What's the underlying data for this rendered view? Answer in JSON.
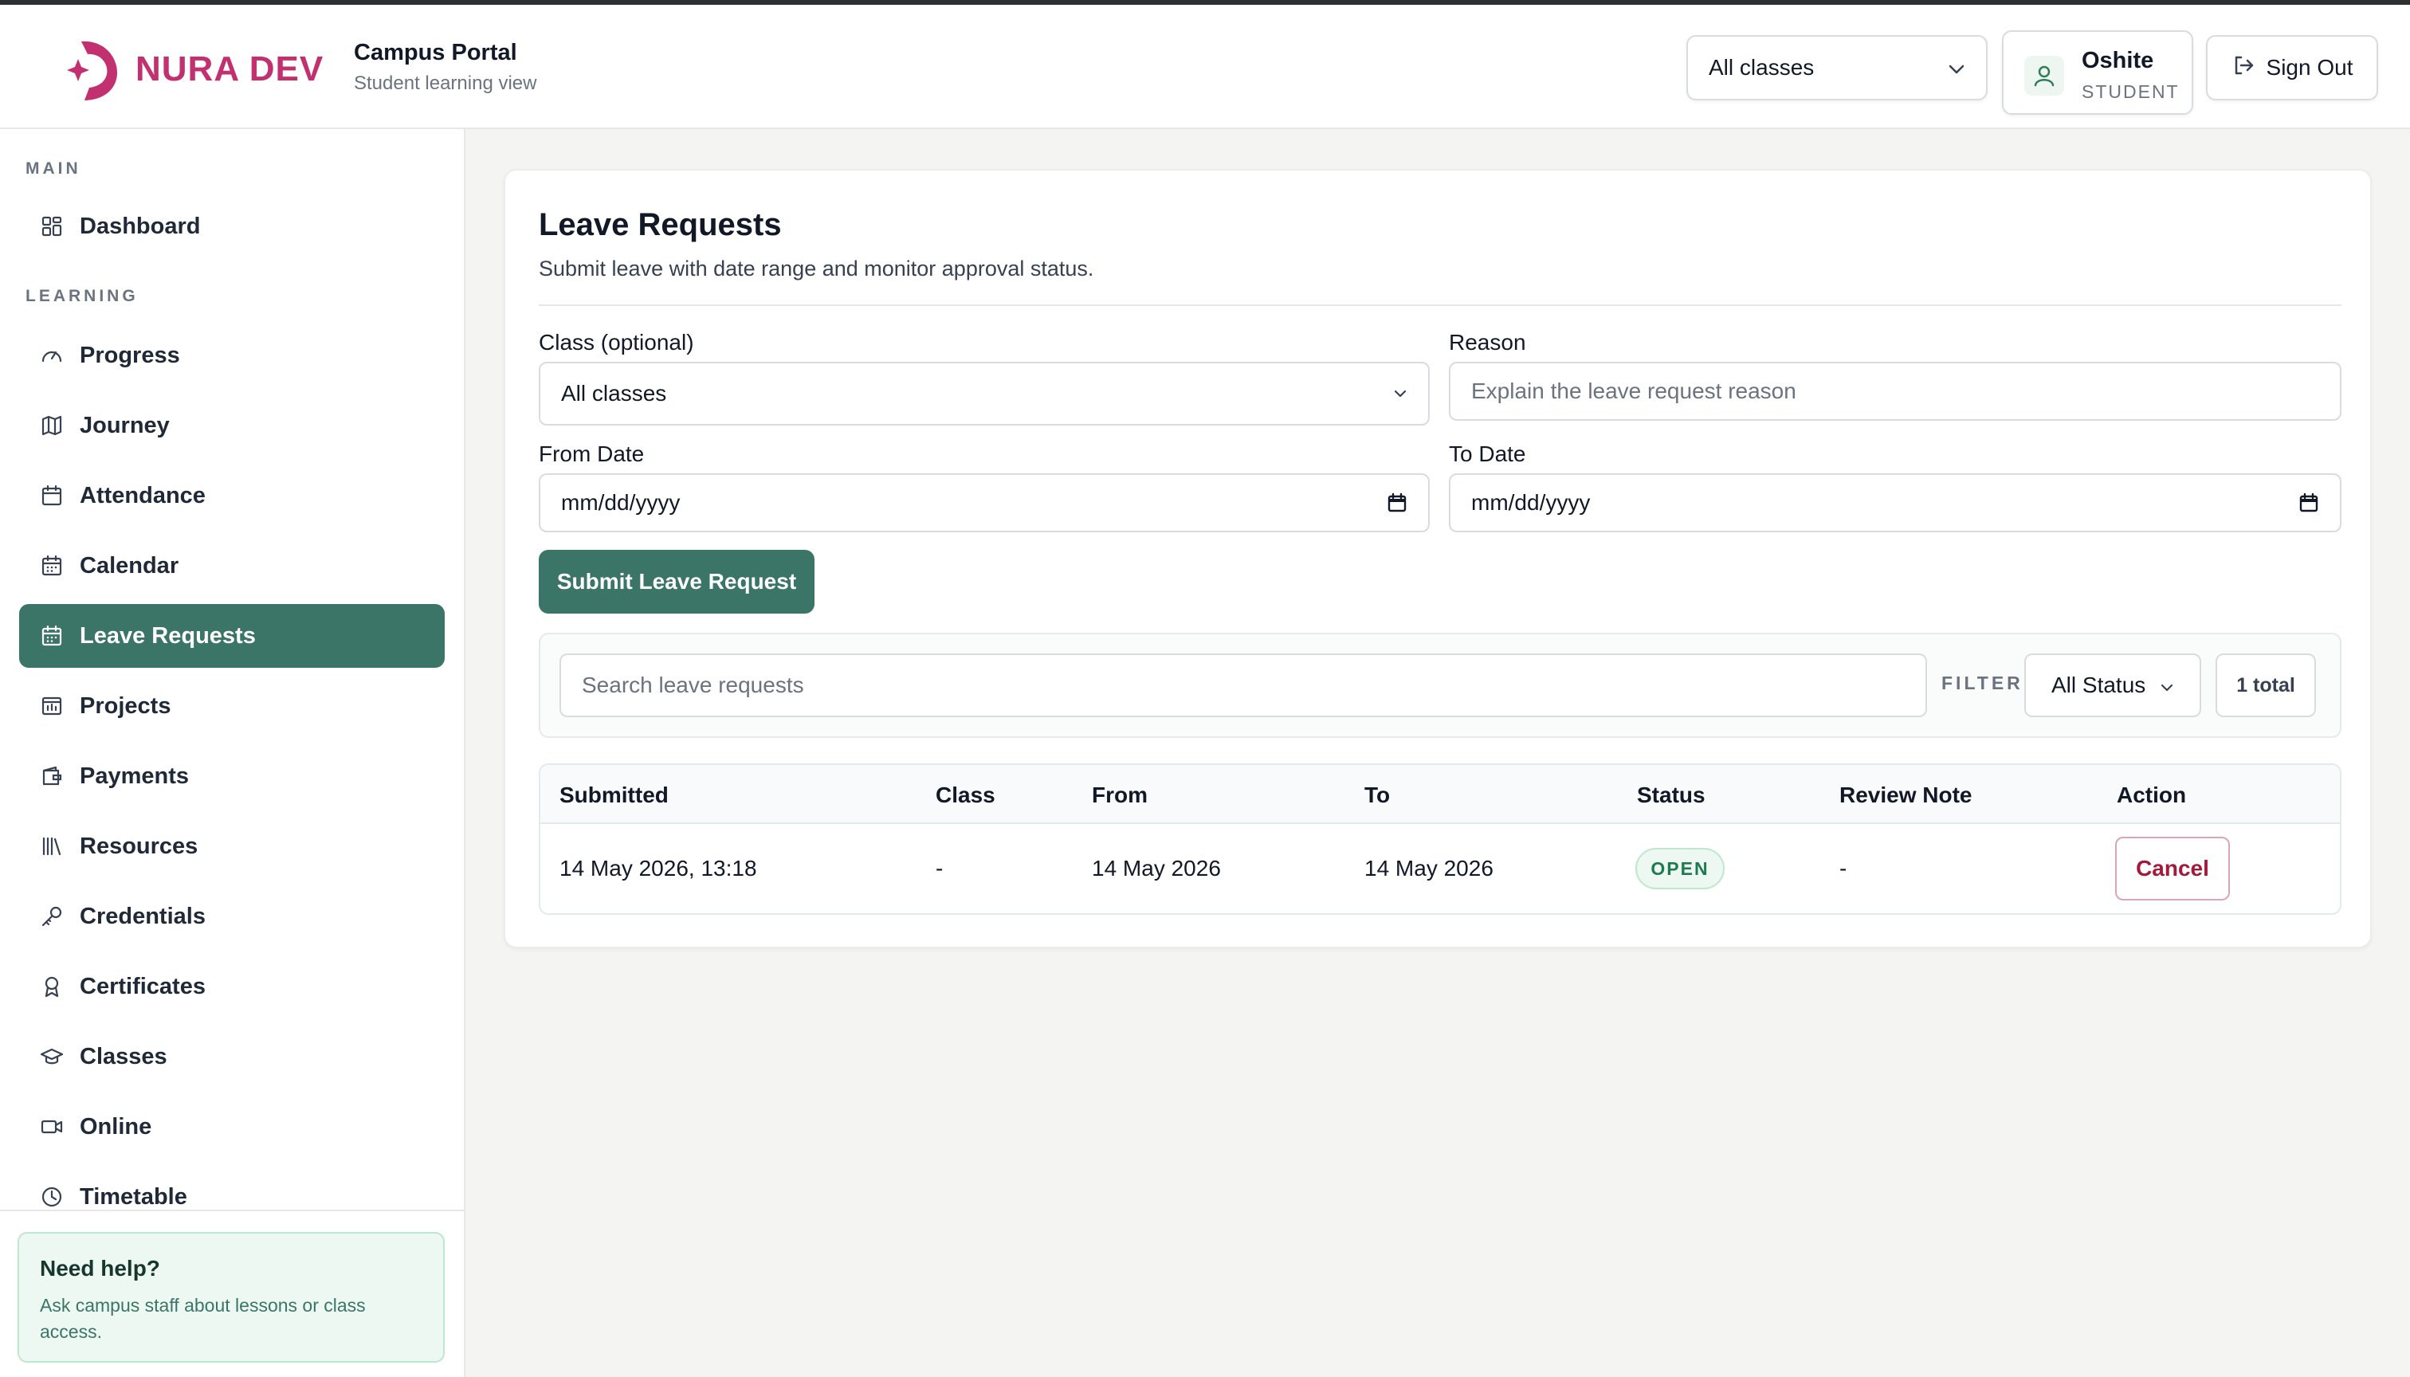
{
  "header": {
    "logo_text": "NURA DEV",
    "app_title": "Campus Portal",
    "app_subtitle": "Student learning view",
    "class_select_value": "All classes",
    "user_name": "Oshite",
    "user_role": "STUDENT",
    "signout_label": "Sign Out"
  },
  "sidebar": {
    "section_main": "MAIN",
    "section_learning": "LEARNING",
    "items": [
      {
        "label": "Dashboard",
        "icon": "grid-icon"
      },
      {
        "label": "Progress",
        "icon": "gauge-icon"
      },
      {
        "label": "Journey",
        "icon": "map-icon"
      },
      {
        "label": "Attendance",
        "icon": "calendar-check-icon"
      },
      {
        "label": "Calendar",
        "icon": "calendar-icon"
      },
      {
        "label": "Leave Requests",
        "icon": "calendar-icon",
        "active": true
      },
      {
        "label": "Projects",
        "icon": "chart-folder-icon"
      },
      {
        "label": "Payments",
        "icon": "wallet-icon"
      },
      {
        "label": "Resources",
        "icon": "library-icon"
      },
      {
        "label": "Credentials",
        "icon": "key-icon"
      },
      {
        "label": "Certificates",
        "icon": "award-icon"
      },
      {
        "label": "Classes",
        "icon": "graduation-cap-icon"
      },
      {
        "label": "Online",
        "icon": "video-icon"
      },
      {
        "label": "Timetable",
        "icon": "clock-icon"
      }
    ],
    "help": {
      "title": "Need help?",
      "text": "Ask campus staff about lessons or class access."
    }
  },
  "main": {
    "title": "Leave Requests",
    "subtitle": "Submit leave with date range and monitor approval status.",
    "form": {
      "class_label": "Class (optional)",
      "class_value": "All classes",
      "reason_label": "Reason",
      "reason_placeholder": "Explain the leave request reason",
      "from_label": "From Date",
      "from_value": "mm/dd/yyyy",
      "to_label": "To Date",
      "to_value": "mm/dd/yyyy",
      "submit_label": "Submit Leave Request"
    },
    "filter": {
      "search_placeholder": "Search leave requests",
      "filter_label": "FILTER",
      "status_value": "All Status",
      "total": "1 total"
    },
    "table": {
      "columns": [
        "Submitted",
        "Class",
        "From",
        "To",
        "Status",
        "Review Note",
        "Action"
      ],
      "rows": [
        {
          "submitted": "14 May 2026, 13:18",
          "class": "-",
          "from": "14 May 2026",
          "to": "14 May 2026",
          "status": "OPEN",
          "review_note": "-",
          "action": "Cancel"
        }
      ]
    }
  },
  "colors": {
    "accent": "#3a7567",
    "brand": "#c2306f",
    "danger": "#a3193c",
    "status_open": "#1f7a4f"
  }
}
